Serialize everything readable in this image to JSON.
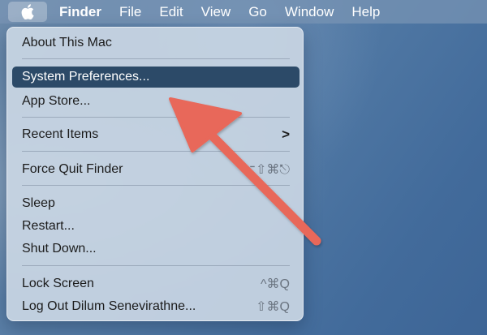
{
  "menubar": {
    "apple_icon": "apple-logo-icon",
    "items": [
      "Finder",
      "File",
      "Edit",
      "View",
      "Go",
      "Window",
      "Help"
    ]
  },
  "apple_menu": {
    "items": [
      {
        "label": "About This Mac"
      },
      {
        "label": "System Preferences...",
        "highlighted": true
      },
      {
        "label": "App Store..."
      },
      {
        "label": "Recent Items",
        "submenu_icon": "chevron-right-icon",
        "submenu": ">"
      },
      {
        "label": "Force Quit Finder",
        "shortcut": "⌥⇧⌘⎋"
      },
      {
        "label": "Sleep"
      },
      {
        "label": "Restart..."
      },
      {
        "label": "Shut Down..."
      },
      {
        "label": "Lock Screen",
        "shortcut": "^⌘Q"
      },
      {
        "label": "Log Out Dilum Senevirathne...",
        "shortcut": "⇧⌘Q"
      }
    ]
  },
  "annotation": {
    "arrow_icon": "pointer-arrow-icon",
    "color": "#e8675a"
  },
  "colors": {
    "highlight": "#2c4a68",
    "menu_bg": "#c8d5e3",
    "desktop": "#4f77a3"
  }
}
